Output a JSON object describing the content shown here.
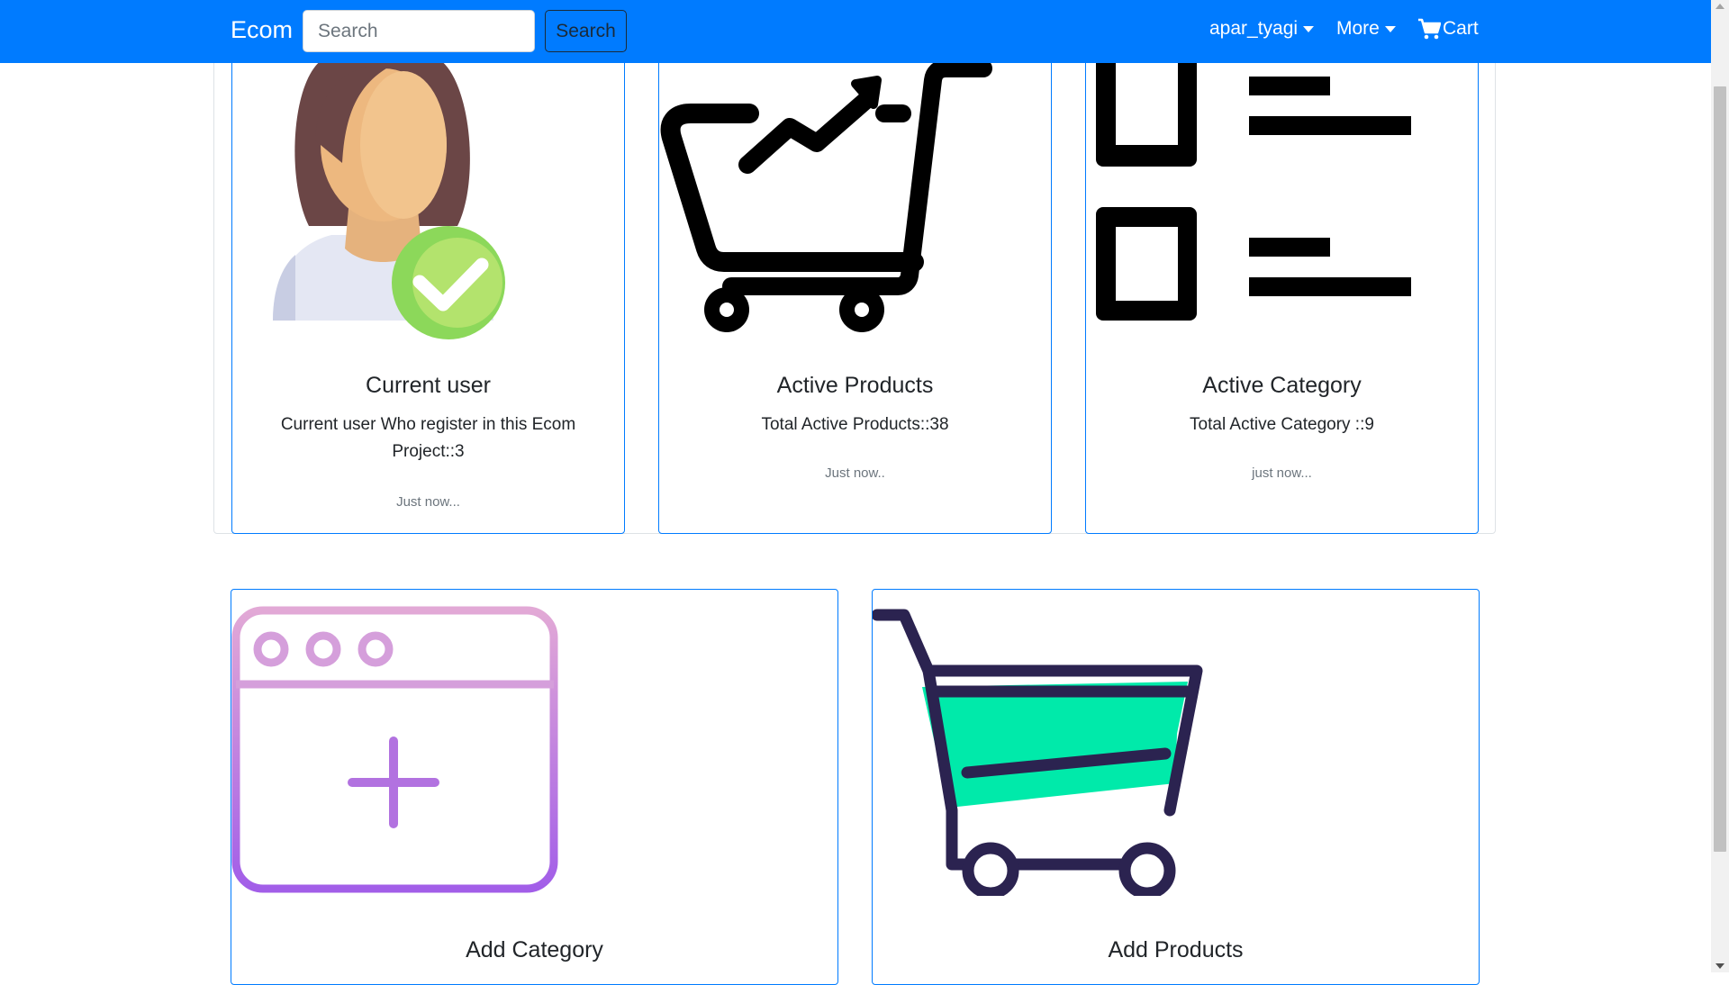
{
  "navbar": {
    "brand": "Ecom",
    "search_placeholder": "Search",
    "search_button": "Search",
    "user_menu": "apar_tyagi",
    "more_menu": "More",
    "cart": "Cart"
  },
  "stats": [
    {
      "title": "Current user",
      "text": "Current user Who register in this Ecom Project::3",
      "time": "Just now...",
      "icon": "user-check-icon"
    },
    {
      "title": "Active Products",
      "text": "Total Active Products::38",
      "time": "Just now..",
      "icon": "cart-growth-icon"
    },
    {
      "title": "Active Category",
      "text": "Total Active Category ::9",
      "time": "just now...",
      "icon": "list-icon"
    }
  ],
  "actions": [
    {
      "title": "Add Category",
      "icon": "browser-add-icon"
    },
    {
      "title": "Add Products",
      "icon": "shopping-cart-icon"
    }
  ],
  "colors": {
    "navbar": "#007bff",
    "card_border": "#007bff",
    "cart_fill": "#00eaaa",
    "cart_stroke": "#2b2350",
    "check_green": "#8cd85a"
  }
}
